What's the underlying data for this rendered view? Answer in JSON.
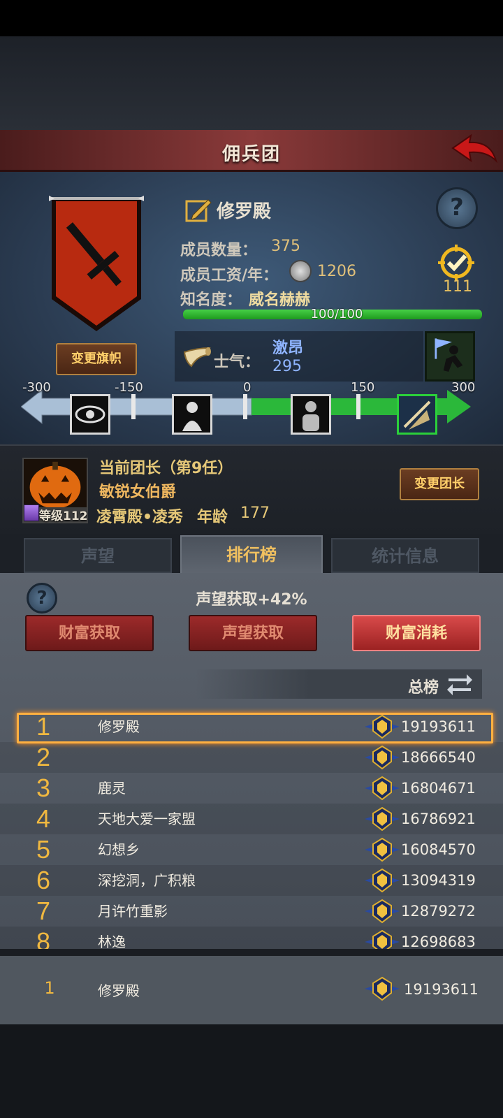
{
  "header": {
    "title": "佣兵团"
  },
  "guild": {
    "name": "修罗殿",
    "member_label": "成员数量：",
    "member_count": "375",
    "wage_label": "成员工资/年：",
    "wage": "1206",
    "fame_label": "知名度：",
    "fame_title": "威名赫赫",
    "fame_progress": "100/100",
    "fame_fraction": 1.0,
    "badge_count": "111",
    "change_flag_label": "变更旗帜"
  },
  "morale": {
    "label": "士气：",
    "state": "激昂",
    "value": "295",
    "ticks": [
      "-300",
      "-150",
      "0",
      "150",
      "300"
    ]
  },
  "leader": {
    "title": "当前团长（第9任）",
    "name": "敏锐女伯爵",
    "level": "等级112",
    "house": "凌霄殿•凌秀",
    "age_label": "年龄",
    "age": "177",
    "change_label": "变更团长"
  },
  "tabs": [
    {
      "label": "声望"
    },
    {
      "label": "排行榜"
    },
    {
      "label": "统计信息"
    }
  ],
  "ranking": {
    "bonus_text": "声望获取+42%",
    "buttons": [
      {
        "label": "财富获取"
      },
      {
        "label": "声望获取"
      },
      {
        "label": "财富消耗"
      }
    ],
    "scope_label": "总榜",
    "rows": [
      {
        "rank": "1",
        "name": "修罗殿",
        "score": "19193611"
      },
      {
        "rank": "2",
        "name": "",
        "score": "18666540"
      },
      {
        "rank": "3",
        "name": "鹿灵",
        "score": "16804671"
      },
      {
        "rank": "4",
        "name": "天地大爱一家盟",
        "score": "16786921"
      },
      {
        "rank": "5",
        "name": "幻想乡",
        "score": "16084570"
      },
      {
        "rank": "6",
        "name": "深挖洞，广积粮",
        "score": "13094319"
      },
      {
        "rank": "7",
        "name": "月许竹重影",
        "score": "12879272"
      },
      {
        "rank": "8",
        "name": "林逸",
        "score": "12698683"
      }
    ],
    "mine": {
      "rank": "1",
      "name": "修罗殿",
      "score": "19193611"
    }
  },
  "colors": {
    "accent_gold": "#f0b840",
    "morale_blue": "#8fb4ff",
    "fame_green": "#2fb52f",
    "banner_red": "#b82a10"
  }
}
